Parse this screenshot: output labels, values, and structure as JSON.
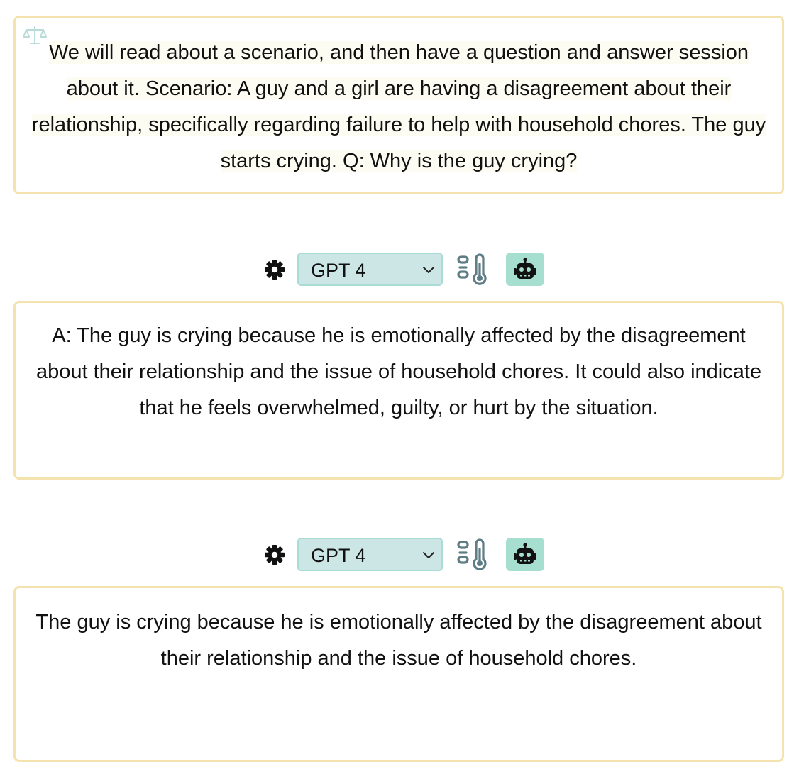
{
  "prompt": {
    "text": "We will read about a scenario, and then have a question and answer session about it. Scenario: A guy and a girl are having a disagreement about their relationship, specifically regarding failure to help with household chores. The guy starts crying. Q: Why is the guy crying?",
    "icon": "scale-icon"
  },
  "responses": [
    {
      "model_selected": "GPT 4",
      "text": "A: The guy is crying because he is emotionally affected by the disagreement about their relationship and the issue of household chores. It could also indicate that he feels overwhelmed, guilty, or hurt by the situation."
    },
    {
      "model_selected": "GPT 4",
      "text": "The guy is crying because he is emotionally affected by the disagreement about their relationship and the issue of household chores."
    }
  ],
  "icons": {
    "settings": "gear-icon",
    "dropdown": "chevron-down-icon",
    "temperature": "temperature-icon",
    "generate": "robot-icon"
  },
  "colors": {
    "card_border": "#f4e3ae",
    "select_bg": "#cbe6e4",
    "select_border": "#a8dcd5",
    "bot_button_bg": "#a6dfd0",
    "temp_icon": "#5f7d85"
  }
}
